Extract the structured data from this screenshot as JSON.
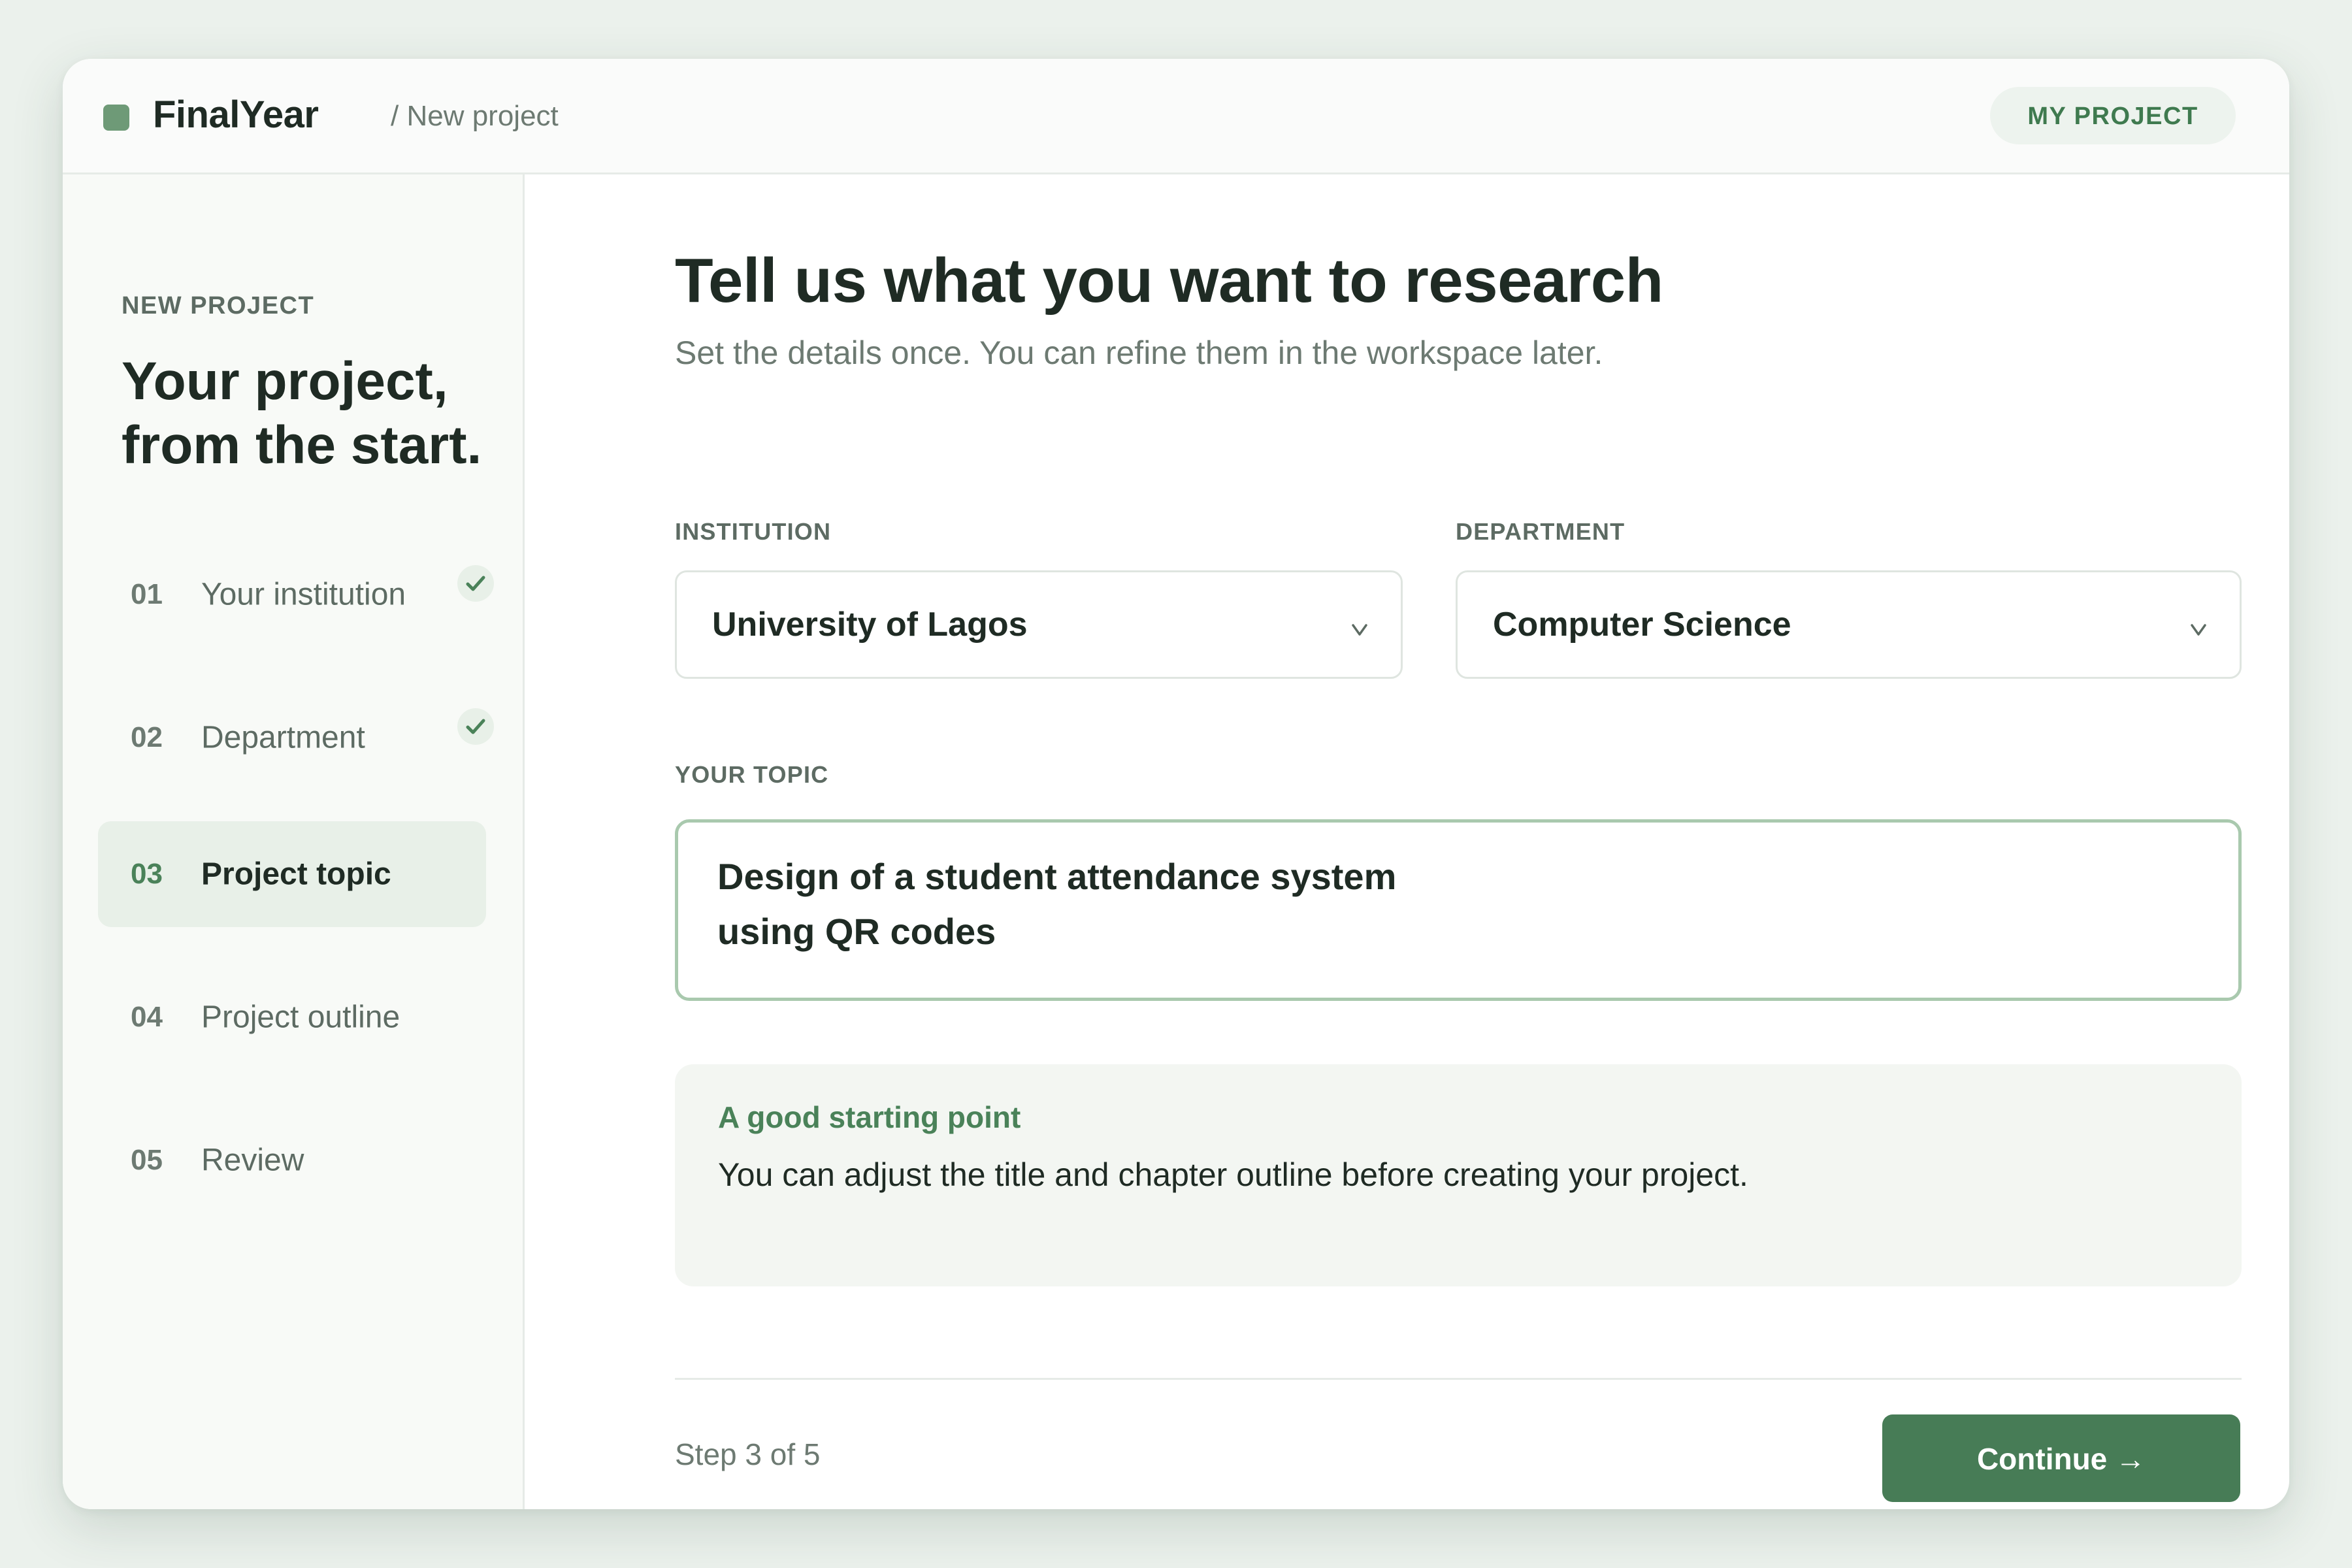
{
  "colors": {
    "accent": "#477c56",
    "accent_light": "#e8f0e8",
    "background": "#ebf1ec",
    "text": "#1f2b24",
    "muted": "#6d7a72"
  },
  "header": {
    "brand": "FinalYear",
    "breadcrumb": "/ New project",
    "my_project_label": "MY PROJECT"
  },
  "sidebar": {
    "eyebrow": "NEW PROJECT",
    "title_line1": "Your project,",
    "title_line2": "from the start.",
    "steps": [
      {
        "num": "01",
        "label": "Your institution",
        "completed": true,
        "active": false
      },
      {
        "num": "02",
        "label": "Department",
        "completed": true,
        "active": false
      },
      {
        "num": "03",
        "label": "Project topic",
        "completed": false,
        "active": true
      },
      {
        "num": "04",
        "label": "Project outline",
        "completed": false,
        "active": false
      },
      {
        "num": "05",
        "label": "Review",
        "completed": false,
        "active": false
      }
    ]
  },
  "main": {
    "title": "Tell us what you want to research",
    "subtitle": "Set the details once. You can refine them in the workspace later.",
    "institution": {
      "label": "INSTITUTION",
      "value": "University of Lagos",
      "chevron": "v"
    },
    "department": {
      "label": "DEPARTMENT",
      "value": "Computer Science",
      "chevron": "v"
    },
    "topic": {
      "label": "YOUR TOPIC",
      "line1": "Design of a student attendance system",
      "line2": "using QR codes"
    },
    "tip": {
      "title": "A good starting point",
      "text": "You can adjust the title and chapter outline before creating your project."
    },
    "step_indicator": "Step 3 of 5",
    "continue_label": "Continue →"
  }
}
